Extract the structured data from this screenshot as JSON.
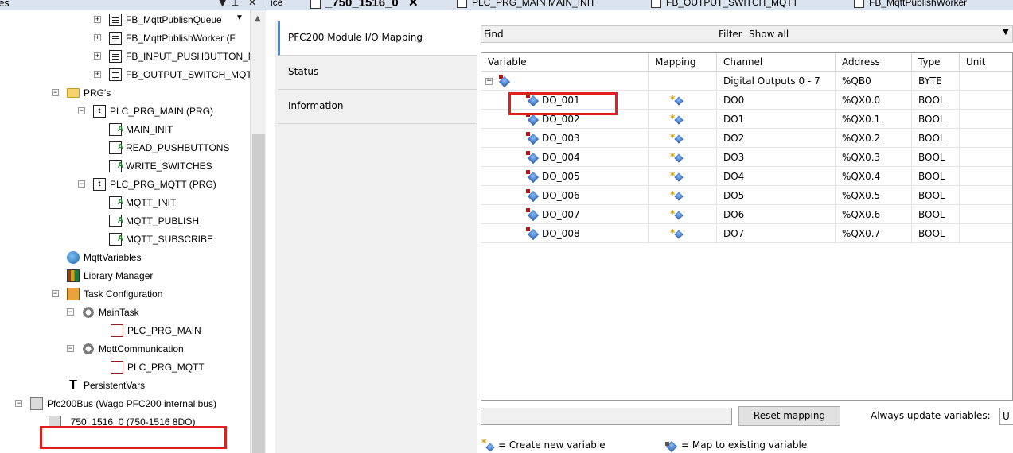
{
  "left_panel": {
    "title": "es",
    "tree": [
      {
        "label": "FB_MqttPublishQueue",
        "icon": "pou-icon",
        "indent": 2
      },
      {
        "label": "FB_MqttPublishWorker (F",
        "icon": "pou-icon",
        "indent": 2
      },
      {
        "label": "FB_INPUT_PUSHBUTTON_MC",
        "icon": "pou-icon",
        "indent": 2
      },
      {
        "label": "FB_OUTPUT_SWITCH_MQTT",
        "icon": "pou-icon",
        "indent": 2
      },
      {
        "label": "PRG's",
        "icon": "folder-icon",
        "indent": 1
      },
      {
        "label": "PLC_PRG_MAIN (PRG)",
        "icon": "prg-icon",
        "indent": 2
      },
      {
        "label": "MAIN_INIT",
        "icon": "action-icon",
        "indent": 3
      },
      {
        "label": "READ_PUSHBUTTONS",
        "icon": "action-icon",
        "indent": 3
      },
      {
        "label": "WRITE_SWITCHES",
        "icon": "action-icon",
        "indent": 3
      },
      {
        "label": "PLC_PRG_MQTT (PRG)",
        "icon": "prg-icon",
        "indent": 2
      },
      {
        "label": "MQTT_INIT",
        "icon": "action-icon",
        "indent": 3
      },
      {
        "label": "MQTT_PUBLISH",
        "icon": "action-icon",
        "indent": 3
      },
      {
        "label": "MQTT_SUBSCRIBE",
        "icon": "action-icon",
        "indent": 3
      },
      {
        "label": "MqttVariables",
        "icon": "globe-icon",
        "indent": 1
      },
      {
        "label": "Library Manager",
        "icon": "lib-icon",
        "indent": 1
      },
      {
        "label": "Task Configuration",
        "icon": "task-cfg-icon",
        "indent": 1
      },
      {
        "label": "MainTask",
        "icon": "task-icon",
        "indent": 2
      },
      {
        "label": "PLC_PRG_MAIN",
        "icon": "call-icon",
        "indent": 3
      },
      {
        "label": "MqttCommunication",
        "icon": "task-icon",
        "indent": 2
      },
      {
        "label": "PLC_PRG_MQTT",
        "icon": "call-icon",
        "indent": 3
      },
      {
        "label": "PersistentVars",
        "icon": "persist-icon",
        "indent": 1
      },
      {
        "label": "Pfc200Bus (Wago PFC200 internal bus)",
        "icon": "device-icon",
        "indent": 0
      },
      {
        "label": "_750_1516_0 (750-1516 8DO)",
        "icon": "device-icon",
        "indent": 1
      }
    ]
  },
  "tabs": [
    {
      "label": "ice"
    },
    {
      "label": "_750_1516_0",
      "active": true
    },
    {
      "label": "PLC_PRG_MAIN.MAIN_INIT"
    },
    {
      "label": "FB_OUTPUT_SWITCH_MQTT"
    },
    {
      "label": "FB_MqttPublishWorker"
    }
  ],
  "side_tabs": [
    {
      "label": "PFC200 Module I/O Mapping",
      "active": true
    },
    {
      "label": "Status"
    },
    {
      "label": "Information"
    }
  ],
  "find_bar": {
    "find_label": "Find",
    "filter_label": "Filter",
    "filter_value": "Show all"
  },
  "grid": {
    "columns": [
      "Variable",
      "Mapping",
      "Channel",
      "Address",
      "Type",
      "Unit"
    ],
    "parent_row": {
      "variable": "",
      "channel": "Digital Outputs 0 - 7",
      "address": "%QB0",
      "type": "BYTE"
    },
    "rows": [
      {
        "variable": "DO_001",
        "channel": "DO0",
        "address": "%QX0.0",
        "type": "BOOL"
      },
      {
        "variable": "DO_002",
        "channel": "DO1",
        "address": "%QX0.1",
        "type": "BOOL"
      },
      {
        "variable": "DO_003",
        "channel": "DO2",
        "address": "%QX0.2",
        "type": "BOOL"
      },
      {
        "variable": "DO_004",
        "channel": "DO3",
        "address": "%QX0.3",
        "type": "BOOL"
      },
      {
        "variable": "DO_005",
        "channel": "DO4",
        "address": "%QX0.4",
        "type": "BOOL"
      },
      {
        "variable": "DO_006",
        "channel": "DO5",
        "address": "%QX0.5",
        "type": "BOOL"
      },
      {
        "variable": "DO_007",
        "channel": "DO6",
        "address": "%QX0.6",
        "type": "BOOL"
      },
      {
        "variable": "DO_008",
        "channel": "DO7",
        "address": "%QX0.7",
        "type": "BOOL"
      }
    ]
  },
  "bottom_bar": {
    "reset_label": "Reset mapping",
    "always_label": "Always update variables:",
    "always_value": "U"
  },
  "legend": {
    "create_label": "= Create new variable",
    "map_label": "= Map to existing variable"
  },
  "colors": {
    "highlight": "#e02020",
    "active_tab_accent": "#3d8ee0"
  }
}
